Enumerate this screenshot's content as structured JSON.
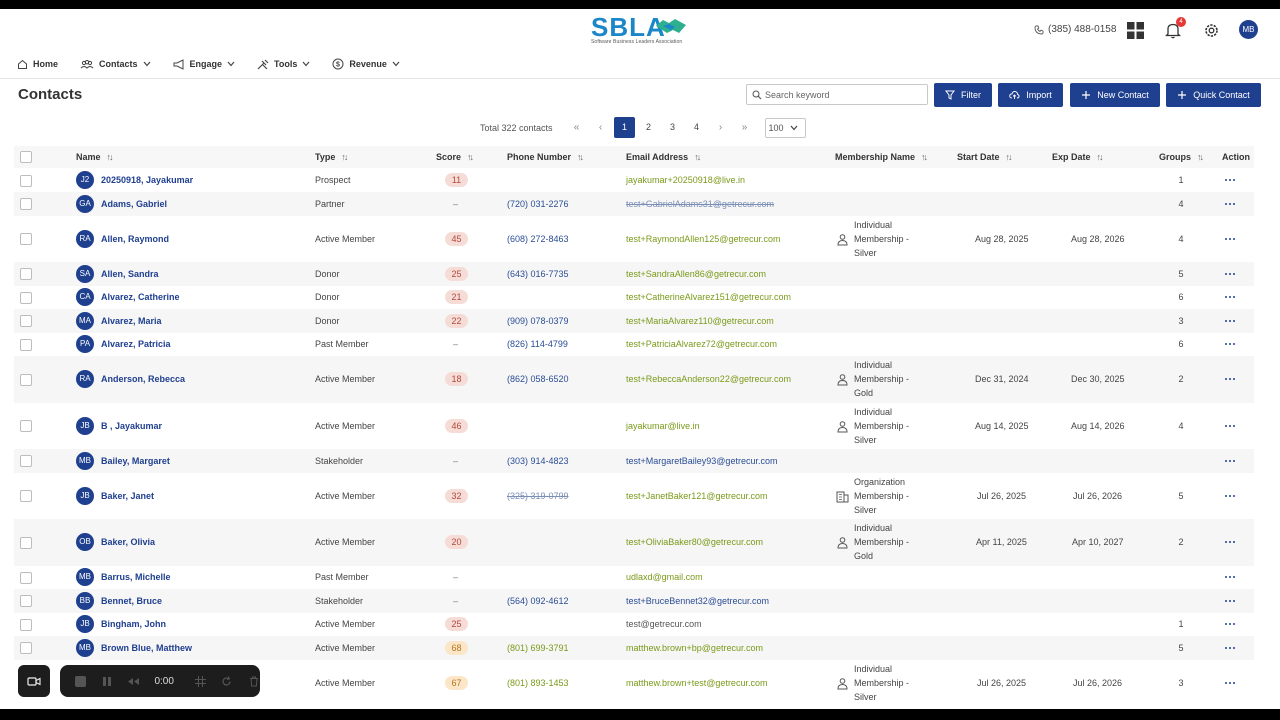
{
  "header": {
    "logo_text": "SBLA",
    "logo_sub": "Software Business Leaders Association",
    "phone": "(385) 488-0158",
    "notifications_count": "4",
    "user_initials": "MB"
  },
  "nav": {
    "items": [
      {
        "label": "Home",
        "icon": "home-icon"
      },
      {
        "label": "Contacts",
        "icon": "people-icon"
      },
      {
        "label": "Engage",
        "icon": "megaphone-icon"
      },
      {
        "label": "Tools",
        "icon": "tools-icon"
      },
      {
        "label": "Revenue",
        "icon": "dollar-icon"
      }
    ]
  },
  "page": {
    "title": "Contacts",
    "search_placeholder": "Search keyword",
    "buttons": {
      "filter": "Filter",
      "import": "Import",
      "new_contact": "New Contact",
      "quick_contact": "Quick Contact"
    }
  },
  "pager": {
    "total": "Total 322 contacts",
    "pages": [
      "1",
      "2",
      "3",
      "4"
    ],
    "page_size": "100"
  },
  "table": {
    "headers": {
      "name": "Name",
      "type": "Type",
      "score": "Score",
      "phone": "Phone Number",
      "email": "Email Address",
      "membership": "Membership Name",
      "start": "Start Date",
      "exp": "Exp Date",
      "groups": "Groups",
      "action": "Action"
    },
    "rows": [
      {
        "initials": "J2",
        "name": "20250918, Jayakumar",
        "type": "Prospect",
        "score": "11",
        "phone": "",
        "email": "jayakumar+20250918@live.in",
        "membership": "",
        "start": "",
        "exp": "",
        "groups": "1"
      },
      {
        "initials": "GA",
        "name": "Adams, Gabriel",
        "type": "Partner",
        "score": "–",
        "phone": "(720) 031-2276",
        "email": "test+GabrielAdams31@getrecur.com",
        "membership": "",
        "start": "",
        "exp": "",
        "groups": "4"
      },
      {
        "initials": "RA",
        "name": "Allen, Raymond",
        "type": "Active Member",
        "score": "45",
        "phone": "(608) 272-8463",
        "email": "test+RaymondAllen125@getrecur.com",
        "membership": "Individual Membership - Silver",
        "start": "Aug 28, 2025",
        "exp": "Aug 28, 2026",
        "groups": "4"
      },
      {
        "initials": "SA",
        "name": "Allen, Sandra",
        "type": "Donor",
        "score": "25",
        "phone": "(643) 016-7735",
        "email": "test+SandraAllen86@getrecur.com",
        "membership": "",
        "start": "",
        "exp": "",
        "groups": "5"
      },
      {
        "initials": "CA",
        "name": "Alvarez, Catherine",
        "type": "Donor",
        "score": "21",
        "phone": "",
        "email": "test+CatherineAlvarez151@getrecur.com",
        "membership": "",
        "start": "",
        "exp": "",
        "groups": "6"
      },
      {
        "initials": "MA",
        "name": "Alvarez, Maria",
        "type": "Donor",
        "score": "22",
        "phone": "(909) 078-0379",
        "email": "test+MariaAlvarez110@getrecur.com",
        "membership": "",
        "start": "",
        "exp": "",
        "groups": "3"
      },
      {
        "initials": "PA",
        "name": "Alvarez, Patricia",
        "type": "Past Member",
        "score": "–",
        "phone": "(826) 114-4799",
        "email": "test+PatriciaAlvarez72@getrecur.com",
        "membership": "",
        "start": "",
        "exp": "",
        "groups": "6"
      },
      {
        "initials": "RA",
        "name": "Anderson, Rebecca",
        "type": "Active Member",
        "score": "18",
        "phone": "(862) 058-6520",
        "email": "test+RebeccaAnderson22@getrecur.com",
        "membership": "Individual Membership - Gold",
        "start": "Dec 31, 2024",
        "exp": "Dec 30, 2025",
        "groups": "2"
      },
      {
        "initials": "JB",
        "name": "B , Jayakumar",
        "type": "Active Member",
        "score": "46",
        "phone": "",
        "email": "jayakumar@live.in",
        "membership": "Individual Membership - Silver",
        "start": "Aug 14, 2025",
        "exp": "Aug 14, 2026",
        "groups": "4"
      },
      {
        "initials": "MB",
        "name": "Bailey, Margaret",
        "type": "Stakeholder",
        "score": "–",
        "phone": "(303) 914-4823",
        "email": "test+MargaretBailey93@getrecur.com",
        "membership": "",
        "start": "",
        "exp": "",
        "groups": ""
      },
      {
        "initials": "JB",
        "name": "Baker, Janet",
        "type": "Active Member",
        "score": "32",
        "phone": "(325) 319-0799",
        "email": "test+JanetBaker121@getrecur.com",
        "membership": "Organization Membership - Silver",
        "start": "Jul 26, 2025",
        "exp": "Jul 26, 2026",
        "groups": "5"
      },
      {
        "initials": "OB",
        "name": "Baker, Olivia",
        "type": "Active Member",
        "score": "20",
        "phone": "",
        "email": "test+OliviaBaker80@getrecur.com",
        "membership": "Individual Membership - Gold",
        "start": "Apr 11, 2025",
        "exp": "Apr 10, 2027",
        "groups": "2"
      },
      {
        "initials": "MB",
        "name": "Barrus, Michelle",
        "type": "Past Member",
        "score": "–",
        "phone": "",
        "email": "udlaxd@gmail.com",
        "membership": "",
        "start": "",
        "exp": "",
        "groups": ""
      },
      {
        "initials": "BB",
        "name": "Bennet, Bruce",
        "type": "Stakeholder",
        "score": "–",
        "phone": "(564) 092-4612",
        "email": "test+BruceBennet32@getrecur.com",
        "membership": "",
        "start": "",
        "exp": "",
        "groups": ""
      },
      {
        "initials": "JB",
        "name": "Bingham, John",
        "type": "Active Member",
        "score": "25",
        "phone": "",
        "email": "test@getrecur.com",
        "membership": "",
        "start": "",
        "exp": "",
        "groups": "1"
      },
      {
        "initials": "MB",
        "name": "Brown Blue, Matthew",
        "type": "Active Member",
        "score": "68",
        "phone": "(801) 699-3791",
        "email": "matthew.brown+bp@getrecur.com",
        "membership": "",
        "start": "",
        "exp": "",
        "groups": "5"
      },
      {
        "initials": "",
        "name": "",
        "type": "Active Member",
        "score": "67",
        "phone": "(801) 893-1453",
        "email": "matthew.brown+test@getrecur.com",
        "membership": "Individual Membership - Silver",
        "start": "Jul 26, 2025",
        "exp": "Jul 26, 2026",
        "groups": "3"
      }
    ]
  },
  "recorder": {
    "time": "0:00"
  },
  "colors": {
    "primary": "#1f3f8f",
    "email_green": "#7a9a1a",
    "score_bg": "#f6dcd6",
    "score_orange_bg": "#fbe6c8"
  }
}
